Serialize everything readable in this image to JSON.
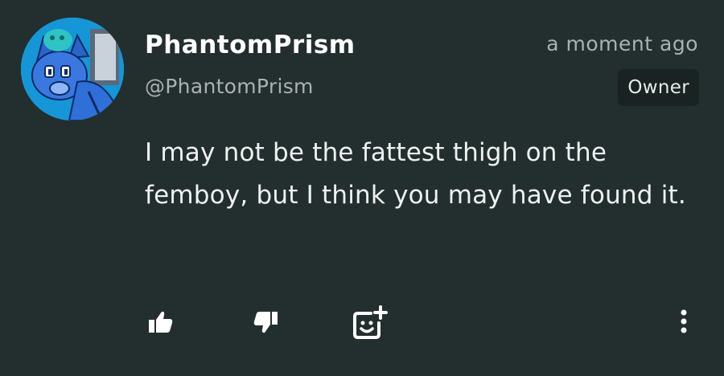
{
  "post": {
    "display_name": "PhantomPrism",
    "username": "@PhantomPrism",
    "timestamp": "a moment ago",
    "role_badge": "Owner",
    "message": "I may not be the fattest thigh on the femboy, but I think you may have found it."
  },
  "actions": {
    "icons": [
      "thumbs-up-icon",
      "thumbs-down-icon",
      "add-reaction-icon",
      "more-vertical-icon"
    ]
  },
  "colors": {
    "background": "#232f2e",
    "secondary_text": "#a9b2b1",
    "badge_background": "#1a2321",
    "avatar_ring": "#1fb6ea"
  }
}
